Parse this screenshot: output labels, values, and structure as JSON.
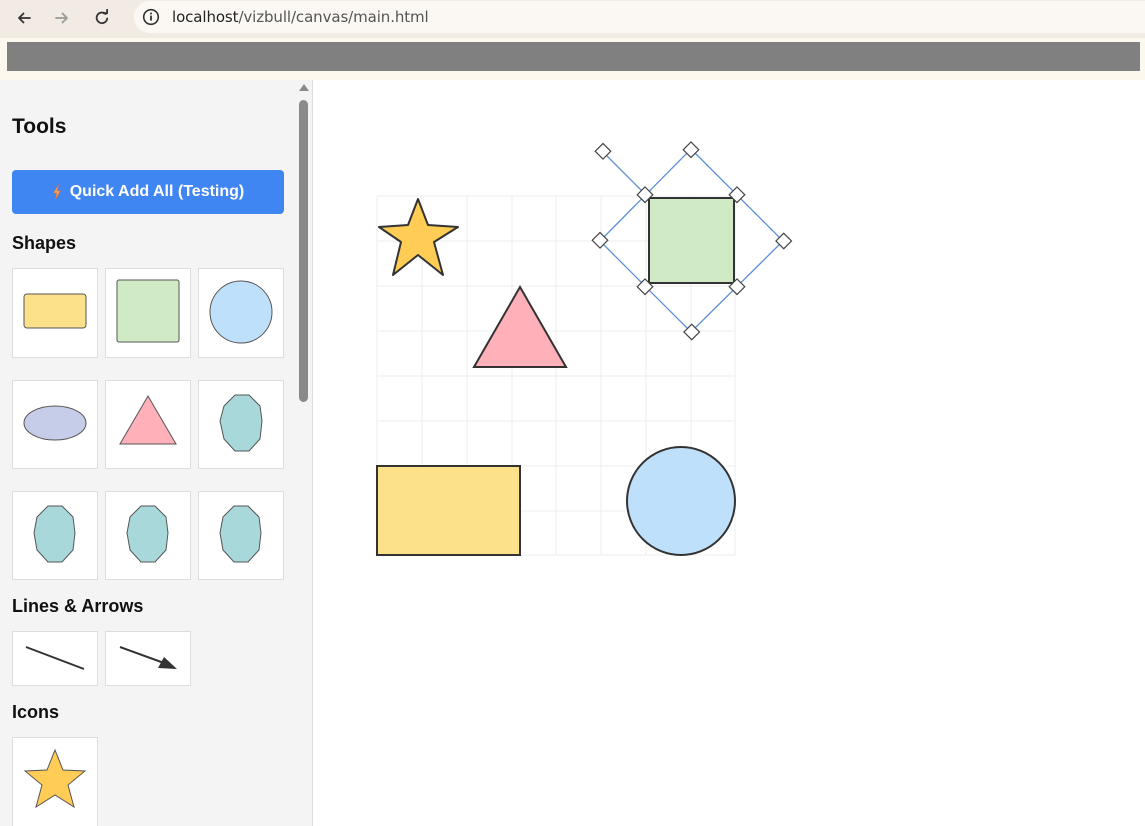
{
  "browser": {
    "url_host": "localhost",
    "url_path": "/vizbull/canvas/main.html",
    "back_icon": "arrow-left-icon",
    "forward_icon": "arrow-right-icon",
    "reload_icon": "reload-icon",
    "info_icon": "info-icon"
  },
  "sidebar": {
    "title": "Tools",
    "quick_add_label": "Quick Add All (Testing)",
    "quick_add_icon": "lightning-icon",
    "shapes_heading": "Shapes",
    "lines_heading": "Lines & Arrows",
    "icons_heading": "Icons",
    "shape_tiles": [
      "rectangle",
      "square",
      "circle",
      "ellipse",
      "triangle",
      "octagon",
      "octagon",
      "octagon",
      "octagon"
    ],
    "line_tiles": [
      "line",
      "arrow"
    ],
    "icon_tiles": [
      "star"
    ]
  },
  "colors": {
    "accent": "#3f86f3",
    "yellow": "#fde18a",
    "green": "#cfeac4",
    "blue": "#bfe0fb",
    "lavender": "#c5cde8",
    "pink": "#ffb0b8",
    "teal": "#a8d8da",
    "star": "#ffcc55",
    "selection": "#5b8fd6"
  }
}
